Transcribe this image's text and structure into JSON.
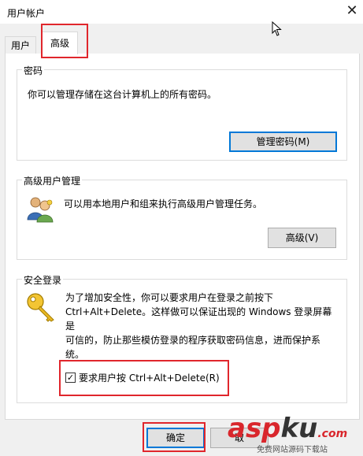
{
  "window": {
    "title": "用户帐户",
    "close_glyph": "✕"
  },
  "tabs": [
    {
      "label": "用户"
    },
    {
      "label": "高级"
    }
  ],
  "password_group": {
    "label": "密码",
    "description": "你可以管理存储在这台计算机上的所有密码。",
    "button": "管理密码(M)"
  },
  "advanced_user_group": {
    "label": "高级用户管理",
    "description": "可以用本地用户和组来执行高级用户管理任务。",
    "button": "高级(V)"
  },
  "secure_logon_group": {
    "label": "安全登录",
    "description_lines": [
      "为了增加安全性，你可以要求用户在登录之前按下",
      "Ctrl+Alt+Delete。这样做可以保证出现的 Windows 登录屏幕是",
      "可信的，防止那些模仿登录的程序获取密码信息，进而保护系",
      "统。"
    ],
    "checkbox_label": "要求用户按 Ctrl+Alt+Delete(R)",
    "checkbox_checked": true
  },
  "footer": {
    "ok_button": "确定",
    "cancel_button_partial": "取"
  },
  "watermark": {
    "brand_1": "asp",
    "brand_2": "ku",
    "brand_tld": ".com",
    "tagline": "免费网站源码下载站"
  },
  "colors": {
    "highlight_red": "#e0262c",
    "focus_blue": "#0078d7",
    "watermark_red": "#d9262c"
  }
}
